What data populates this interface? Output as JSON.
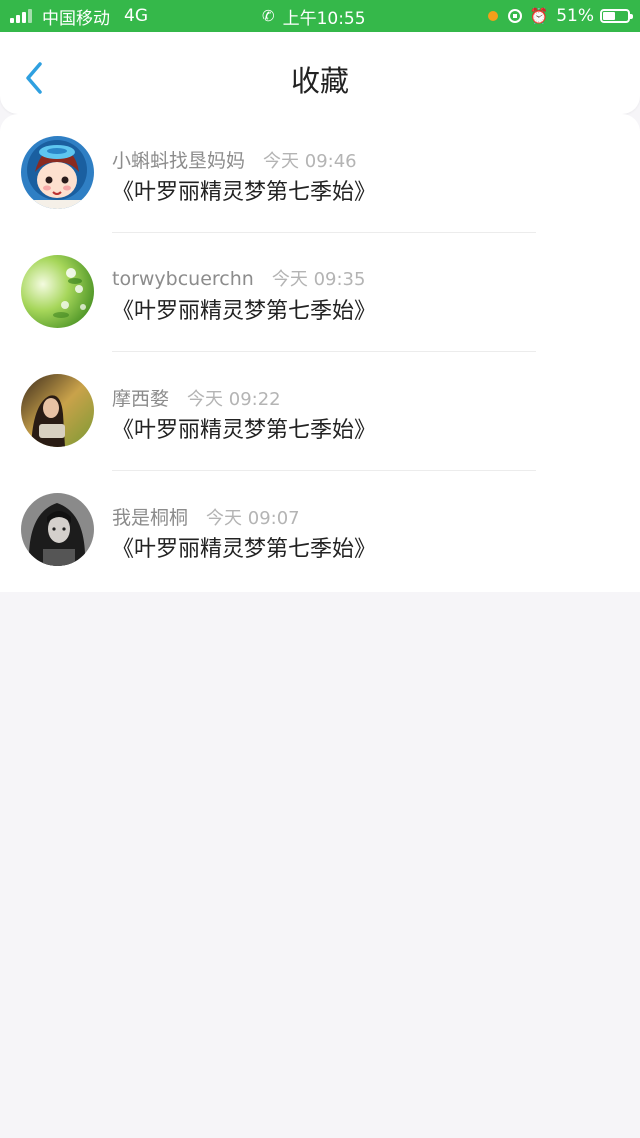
{
  "status_bar": {
    "carrier": "中国移动",
    "network": "4G",
    "time": "上午10:55",
    "battery": "51%",
    "battery_level": 0.51
  },
  "nav": {
    "title": "收藏"
  },
  "items": [
    {
      "name": "小蝌蚪找垦妈妈",
      "time": "今天 09:46",
      "content": "《叶罗丽精灵梦第七季始》"
    },
    {
      "name": "torwybcuerchn",
      "time": "今天 09:35",
      "content": "《叶罗丽精灵梦第七季始》"
    },
    {
      "name": "摩西婺",
      "time": "今天 09:22",
      "content": "《叶罗丽精灵梦第七季始》"
    },
    {
      "name": "我是桐桐",
      "time": "今天 09:07",
      "content": "《叶罗丽精灵梦第七季始》"
    }
  ],
  "colors": {
    "status_bar": "#35b84a",
    "accent": "#2fa0e0"
  }
}
